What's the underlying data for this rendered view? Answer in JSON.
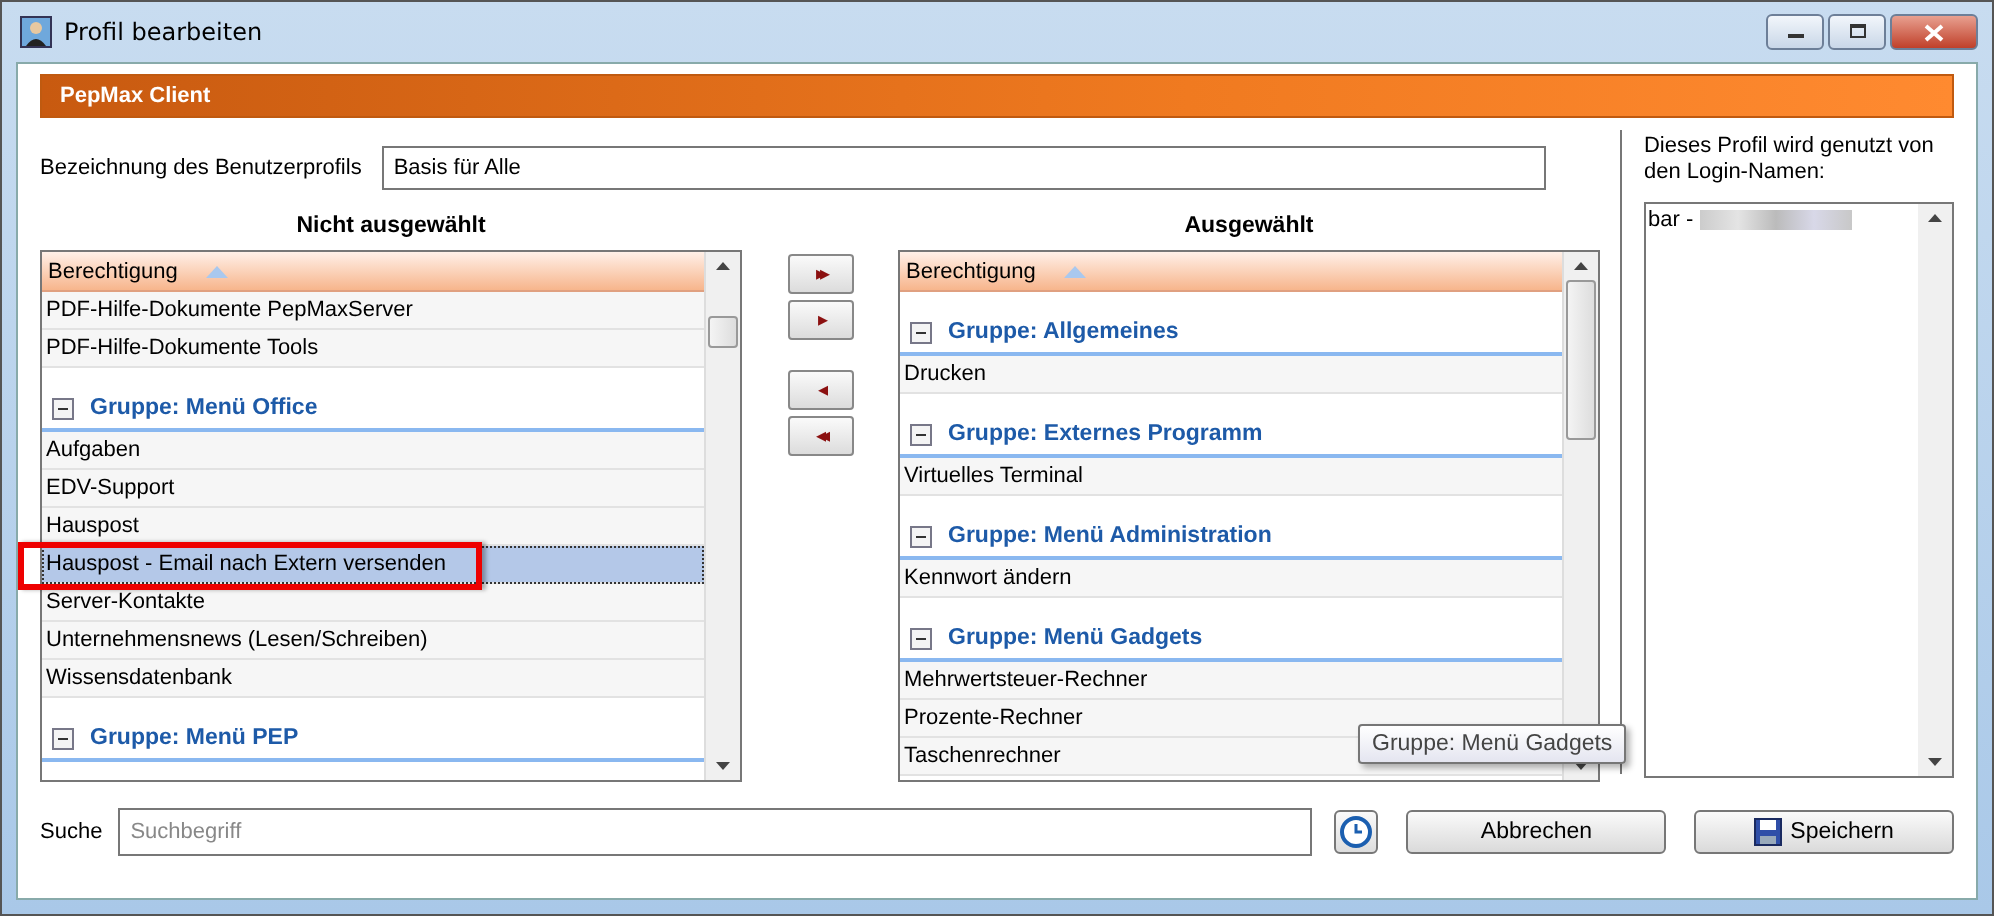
{
  "window": {
    "title": "Profil bearbeiten"
  },
  "banner": "PepMax Client",
  "profile_name": {
    "label": "Bezeichnung des Benutzerprofils",
    "value": "Basis für Alle"
  },
  "available": {
    "heading": "Nicht ausgewählt",
    "column": "Berechtigung",
    "rows": [
      {
        "kind": "item",
        "label": "PDF-Hilfe-Dokumente PepMaxServer",
        "selected": false
      },
      {
        "kind": "item",
        "label": "PDF-Hilfe-Dokumente Tools",
        "selected": false
      },
      {
        "kind": "group",
        "label": "Gruppe: Menü Office",
        "expanded": true
      },
      {
        "kind": "item",
        "label": "Aufgaben",
        "selected": false
      },
      {
        "kind": "item",
        "label": "EDV-Support",
        "selected": false
      },
      {
        "kind": "item",
        "label": "Hauspost",
        "selected": false
      },
      {
        "kind": "item",
        "label": "Hauspost - Email nach Extern versenden",
        "selected": true
      },
      {
        "kind": "item",
        "label": "Server-Kontakte",
        "selected": false
      },
      {
        "kind": "item",
        "label": "Unternehmensnews (Lesen/Schreiben)",
        "selected": false
      },
      {
        "kind": "item",
        "label": "Wissensdatenbank",
        "selected": false
      },
      {
        "kind": "group",
        "label": "Gruppe: Menü PEP",
        "expanded": true
      }
    ]
  },
  "move_buttons": [
    "▸▸",
    "▸",
    "◂",
    "◂◂"
  ],
  "chosen": {
    "heading": "Ausgewählt",
    "column": "Berechtigung",
    "rows": [
      {
        "kind": "group",
        "label": "Gruppe: Allgemeines",
        "expanded": true
      },
      {
        "kind": "item",
        "label": "Drucken",
        "selected": false
      },
      {
        "kind": "group",
        "label": "Gruppe: Externes Programm",
        "expanded": true
      },
      {
        "kind": "item",
        "label": "Virtuelles Terminal",
        "selected": false
      },
      {
        "kind": "group",
        "label": "Gruppe: Menü Administration",
        "expanded": true
      },
      {
        "kind": "item",
        "label": "Kennwort ändern",
        "selected": false
      },
      {
        "kind": "group",
        "label": "Gruppe: Menü Gadgets",
        "expanded": true
      },
      {
        "kind": "item",
        "label": "Mehrwertsteuer-Rechner",
        "selected": false
      },
      {
        "kind": "item",
        "label": "Prozente-Rechner",
        "selected": false
      },
      {
        "kind": "item",
        "label": "Taschenrechner",
        "selected": false
      }
    ]
  },
  "tooltip": "Gruppe: Menü Gadgets",
  "logins": {
    "label": "Dieses Profil wird genutzt von den Login-Namen:",
    "items": [
      "bar -"
    ]
  },
  "search": {
    "label": "Suche",
    "placeholder": "Suchbegriff"
  },
  "buttons": [
    "Abbrechen",
    "Speichern"
  ]
}
